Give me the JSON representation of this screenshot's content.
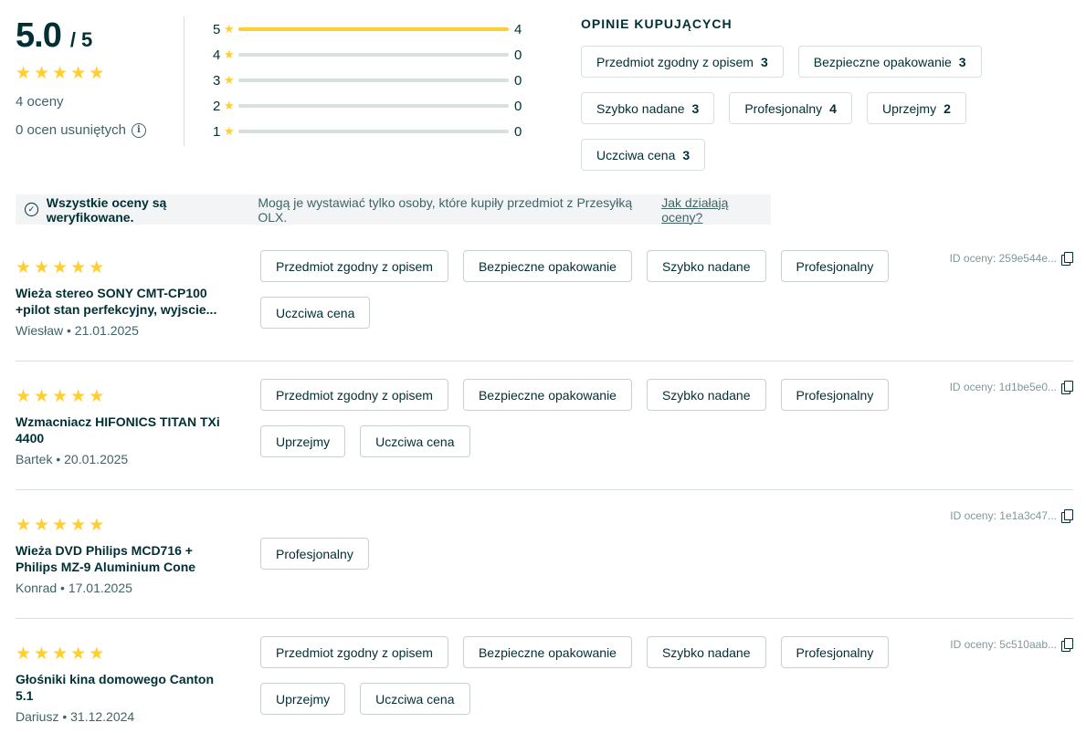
{
  "summary": {
    "score": "5.0",
    "max": "/ 5",
    "stars": 5,
    "count_text": "4 oceny",
    "removed_text": "0 ocen usuniętych",
    "info_icon": "info-icon"
  },
  "distribution": [
    {
      "stars": "5",
      "count": "4",
      "fraction": 1.0
    },
    {
      "stars": "4",
      "count": "0",
      "fraction": 0
    },
    {
      "stars": "3",
      "count": "0",
      "fraction": 0
    },
    {
      "stars": "2",
      "count": "0",
      "fraction": 0
    },
    {
      "stars": "1",
      "count": "0",
      "fraction": 0
    }
  ],
  "opinions": {
    "heading": "OPINIE KUPUJĄCYCH",
    "chips": [
      {
        "label": "Przedmiot zgodny z opisem",
        "count": "3"
      },
      {
        "label": "Bezpieczne opakowanie",
        "count": "3"
      },
      {
        "label": "Szybko nadane",
        "count": "3"
      },
      {
        "label": "Profesjonalny",
        "count": "4"
      },
      {
        "label": "Uprzejmy",
        "count": "2"
      },
      {
        "label": "Uczciwa cena",
        "count": "3"
      }
    ]
  },
  "verified": {
    "bold": "Wszystkie oceny są weryfikowane.",
    "text": "Mogą je wystawiać tylko osoby, które kupiły przedmiot z Przesyłką OLX.",
    "link": "Jak działają oceny?"
  },
  "reviews": [
    {
      "title": "Wieża stereo SONY CMT-CP100 +pilot stan perfekcyjny, wyjscie...",
      "meta": "Wiesław • 21.01.2025",
      "id": "ID oceny: 259e544e...",
      "tags": [
        "Przedmiot zgodny z opisem",
        "Bezpieczne opakowanie",
        "Szybko nadane",
        "Profesjonalny",
        "Uczciwa cena"
      ]
    },
    {
      "title": "Wzmacniacz HIFONICS TITAN TXi 4400",
      "meta": "Bartek • 20.01.2025",
      "id": "ID oceny: 1d1be5e0...",
      "tags": [
        "Przedmiot zgodny z opisem",
        "Bezpieczne opakowanie",
        "Szybko nadane",
        "Profesjonalny",
        "Uprzejmy",
        "Uczciwa cena"
      ]
    },
    {
      "title": "Wieża DVD Philips MCD716 + Philips MZ-9 Aluminium Cone",
      "meta": "Konrad • 17.01.2025",
      "id": "ID oceny: 1e1a3c47...",
      "tags": [
        "Profesjonalny"
      ]
    },
    {
      "title": "Głośniki kina domowego Canton 5.1",
      "meta": "Dariusz • 31.12.2024",
      "id": "ID oceny: 5c510aab...",
      "tags": [
        "Przedmiot zgodny z opisem",
        "Bezpieczne opakowanie",
        "Szybko nadane",
        "Profesjonalny",
        "Uprzejmy",
        "Uczciwa cena"
      ]
    }
  ],
  "colors": {
    "star": "#ffce32",
    "text": "#002f34",
    "muted": "#406367",
    "border": "#d8dfe0"
  }
}
